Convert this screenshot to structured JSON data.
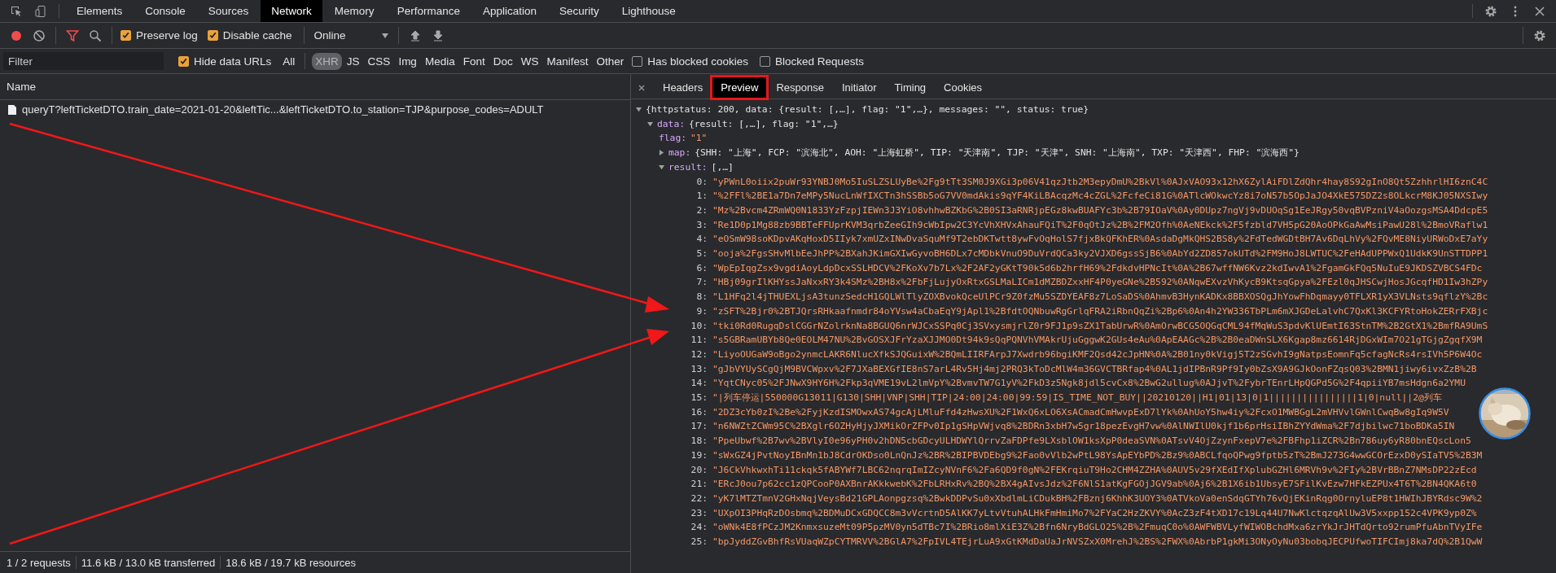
{
  "devtools_tabs": [
    {
      "label": "Elements",
      "selected": false
    },
    {
      "label": "Console",
      "selected": false
    },
    {
      "label": "Sources",
      "selected": false
    },
    {
      "label": "Network",
      "selected": true
    },
    {
      "label": "Memory",
      "selected": false
    },
    {
      "label": "Performance",
      "selected": false
    },
    {
      "label": "Application",
      "selected": false
    },
    {
      "label": "Security",
      "selected": false
    },
    {
      "label": "Lighthouse",
      "selected": false
    }
  ],
  "toolbar": {
    "recording": true,
    "options": [
      {
        "label": "Preserve log",
        "checked": true
      },
      {
        "label": "Disable cache",
        "checked": true
      }
    ],
    "throttling": "Online"
  },
  "filter": {
    "placeholder": "Filter",
    "hide_data_urls": {
      "label": "Hide data URLs",
      "checked": true
    },
    "types": [
      {
        "label": "All",
        "selected": false
      },
      {
        "label": "XHR",
        "selected": true
      },
      {
        "label": "JS",
        "selected": false
      },
      {
        "label": "CSS",
        "selected": false
      },
      {
        "label": "Img",
        "selected": false
      },
      {
        "label": "Media",
        "selected": false
      },
      {
        "label": "Font",
        "selected": false
      },
      {
        "label": "Doc",
        "selected": false
      },
      {
        "label": "WS",
        "selected": false
      },
      {
        "label": "Manifest",
        "selected": false
      },
      {
        "label": "Other",
        "selected": false
      }
    ],
    "options": [
      {
        "label": "Has blocked cookies",
        "checked": false
      },
      {
        "label": "Blocked Requests",
        "checked": false
      }
    ]
  },
  "requests": {
    "column": "Name",
    "rows": [
      {
        "name": "queryT?leftTicketDTO.train_date=2021-01-20&leftTic...&leftTicketDTO.to_station=TJP&purpose_codes=ADULT"
      }
    ]
  },
  "detail_tabs": [
    {
      "label": "Headers",
      "selected": false
    },
    {
      "label": "Preview",
      "selected": true
    },
    {
      "label": "Response",
      "selected": false
    },
    {
      "label": "Initiator",
      "selected": false
    },
    {
      "label": "Timing",
      "selected": false
    },
    {
      "label": "Cookies",
      "selected": false
    }
  ],
  "preview": {
    "kind": "object",
    "preview": "{httpstatus: 200, data: {result: [,…], flag: \"1\",…}, messages: \"\", status: true}",
    "expanded": true,
    "children": [
      {
        "kind": "object",
        "key": "data:",
        "preview": "{result: [,…], flag: \"1\",…}",
        "expanded": true,
        "children": [
          {
            "kind": "leaf",
            "key": "flag:",
            "value": "\"1\""
          },
          {
            "kind": "object",
            "key": "map:",
            "preview": "{SHH: \"上海\", FCP: \"滨海北\", AOH: \"上海虹桥\", TIP: \"天津南\", TJP: \"天津\", SNH: \"上海南\", TXP: \"天津西\", FHP: \"滨海西\"}",
            "expanded": false
          },
          {
            "kind": "array",
            "key": "result:",
            "preview": "[,…]",
            "expanded": true,
            "children": [
              {
                "kind": "leaf",
                "key": "0:",
                "value": "\"yPWnL0oiix2puWr93YNBJ0Mo5IuSLZSLUyBe%2Fg9tTt3SM0J9XGi3p06V41qzJtb2M3epyDmU%2BkVl%0AJxVAO93x12hX6ZylAiFDlZdQhr4hay8S92gInO8Qt5ZzhhrlHI6znC4C"
              },
              {
                "kind": "leaf",
                "key": "1:",
                "value": "\"%2FFl%2BE1a7Dn7eMPy5NucLnWfIXCTn3hSSBb5oG7VV0mdAkis9qYF4KiLBAcqzMc4cZGL%2FcfeCi81G%0ATlcWOkwcYz8i7oN57b5OpJaJO4XkE575DZ2s8OLkcrM8KJ05NXSIwy"
              },
              {
                "kind": "leaf",
                "key": "2:",
                "value": "\"Mz%2Bvcm4ZRmWQ0N1833YzFzpjIEWn3J3YiO8vhhwBZKbG%2B0SI3aRNRjpEGz8kwBUAFYc3b%2B79IOaV%0Ay0DUpz7ngVj9vDUOqSg1EeJRgy50vqBVPzniV4aOozgsMSA4DdcpE5"
              },
              {
                "kind": "leaf",
                "key": "3:",
                "value": "\"Re1D0p1Mg88zb9BBTeFFUprKVM3qrbZeeGIh9cWbIpw2C3YcVhXHVxAhauFQiT%2F0qOtJz%2B%2FM2Ofh%0AeNEkck%2F5fzbld7VH5pG20AoOPkGaAwMsiPawU28l%2BmoVRaflw1"
              },
              {
                "kind": "leaf",
                "key": "4:",
                "value": "\"eOSmW98soKDpvAKqHoxD5IIyk7xmUZxINwDvaSquMf9T2ebDKTwtt8ywFvOqHolS7fjxBkQFKhER%0AsdaDgMkQHS2BS8y%2FdTedWGDtBH7Av6DqLhVy%2FQvME8NiyURWoDxE7aYy"
              },
              {
                "kind": "leaf",
                "key": "5:",
                "value": "\"ooja%2FgsSHvMlbEeJhPP%2BXahJKimGXIwGyvoBH6DLx7cMDbkVnuO9DuVrdQCa3ky2VJXD6gssSjB6%0AbYd2ZD857okUTd%2FM9HoJ8LWTUC%2FeHAdUPPWxQ1UdkK9UnSTTDPP1"
              },
              {
                "kind": "leaf",
                "key": "6:",
                "value": "\"WpEpIqgZsx9vgdiAoyLdpDcxSSLHDCV%2FKoXv7b7Lx%2F2AF2yGKtT90k5d6b2hrfH69%2FdkdvHPNcIt%0A%2B67wffNW6Kvz2kdIwvA1%2FgamGkFQq5NuIuE9JKDSZVBCS4FDc"
              },
              {
                "kind": "leaf",
                "key": "7:",
                "value": "\"HBj09grIlKHYssJaNxxRY3k4SMz%2BH8x%2FbFjLujyOxRtxGSLMaLICm1dMZBDZxxHF4P0yeGNe%2B592%0ANqwEXvzVhKycB9KtsqGpya%2FEzl0qJHSCwjHosJGcqfHD1Iw3hZPy"
              },
              {
                "kind": "leaf",
                "key": "8:",
                "value": "\"L1HFq2l4jTHUEXLjsA3tunzSedcH1GQLWlTlyZOXBvokQceUlPCr9Z0fzMu5SZDYEAF8z7LoSaDS%0AhmvB3HynKADKx8BBXOSQgJhYowFhDqmayy0TFLXR1yX3VLNsts9qflzY%2Bc"
              },
              {
                "kind": "leaf",
                "key": "9:",
                "value": "\"zSFT%2Bjr0%2BTJQrsRHkaafnmdr84oYVsw4aCbaEqY9jApl1%2BfdtOQNbuwRgGrlqFRA2iRbnQqZi%2Bp6%0An4h2YW336TbPLm6mXJGDeLalvhC7QxKl3KCFYRtoHokZERrFXBjc"
              },
              {
                "kind": "leaf",
                "key": "10:",
                "value": "\"tki0Rd0RugqDslCGGrNZolrknNa8BGUQ6nrWJCxSSPq0Cj3SVxysmjrlZ0r9FJ1p9sZX1TabUrwR%0AmOrwBCG5OQGqCML94fMqWuS3pdvKlUEmtI63StnTM%2B2GtX1%2BmfRA9UmS"
              },
              {
                "kind": "leaf",
                "key": "11:",
                "value": "\"s5GBRamUBYb8Qe0EOLM47NU%2BvGOSXJFrYzaXJJMO0Dt94k9sQqPQNVhVMAkrUjuGggwK2GUs4eAu%0ApEAAGc%2B%2B0eaDWnSLX6Kgap8mz6614RjDGxWIm7O21gTGjgZgqfX9M"
              },
              {
                "kind": "leaf",
                "key": "12:",
                "value": "\"LiyoOUGaW9oBgo2ynmcLAKR6NlucXfkSJQGuixW%2BQmLIIRFArpJ7Xwdrb96bgiKMF2Qsd42cJpHN%0A%2B01ny0kVigj5T2zSGvhI9gNatpsEomnFq5cfagNcRs4rsIVh5P6W4Oc"
              },
              {
                "kind": "leaf",
                "key": "13:",
                "value": "\"gJbVYUySCgQjM9BVCWpxv%2F7JXaBEXGfIE8nS7arL4Rv5Hj4mj2PRQ3kToDcMlW4m36GVCTBRfap4%0AL1jdIPBnR9Pf9Iy0bZsX9A9GJkOonFZqsQ03%2BMN1jiwy6ivxZzB%2B"
              },
              {
                "kind": "leaf",
                "key": "14:",
                "value": "\"YqtCNyc05%2FJNwX9HY6H%2Fkp3qVME19vL2lmVpY%2BvmvTW7G1yV%2FkD3z5Ngk8jdl5cvCx8%2BwG2ullug%0AJjvT%2FybrTEnrLHpQGPd5G%2F4qpiiYB7msHdgn6a2YMU"
              },
              {
                "kind": "leaf",
                "key": "15:",
                "value": "\"|列车停运|550000G13011|G130|SHH|VNP|SHH|TIP|24:00|24:00|99:59|IS_TIME_NOT_BUY||20210120||H1|01|13|0|1||||||||||||||||1|0|null||2@列车"
              },
              {
                "kind": "leaf",
                "key": "16:",
                "value": "\"2DZ3cYb0zI%2Be%2FyjKzdISMOwxAS74gcAjLMluFfd4zHwsXU%2F1WxQ6xLO6XsACmadCmHwvpExD7lYk%0AhUoY5hw4iy%2FcxO1MWBGgL2mVHVvlGWnlCwqBw8gIq9W5V"
              },
              {
                "kind": "leaf",
                "key": "17:",
                "value": "\"n6NWZtZCWm95C%2BXglr6OZHyHjyJXMikOrZFPv0Ip1gSHpVWjvq8%2BDRn3xbH7w5gr18pezEvgH7vw%0AlNWIlU0kjf1b6prHsiIBhZYYdWma%2F7djbilwc71boBDKa5IN"
              },
              {
                "kind": "leaf",
                "key": "18:",
                "value": "\"PpeUbwf%2B7wv%2BVlyI0e96yPH0v2hDN5cbGDcyULHDWYlQrrvZaFDPfe9LXsblOW1ksXpP0deaSVN%0ATsvV4OjZzynFxepV7e%2FBFhp1iZCR%2Bn786uy6yR80bnEQscLon5"
              },
              {
                "kind": "leaf",
                "key": "19:",
                "value": "\"sWxGZ4jPvtNoyIBnMn1bJ8CdrOKDso0LnQnJz%2BR%2BIPBVDEbg9%2Fao0vVlb2wPtL98YsApEYbPD%2Bz9%0ABCLfqoQPwg9fptb5zT%2BmJ273G4wwGCOrEzxD0ySIaTV5%2B3M"
              },
              {
                "kind": "leaf",
                "key": "20:",
                "value": "\"J6CkVhkwxhTi11ckqk5fABYWf7LBC62nqrqImIZcyNVnF6%2Fa6QD9f0gN%2FEKrqiuT9Ho2CHM4ZZHA%0AUV5v29fXEdIfXplubGZHl6MRVh9v%2FIy%2BVrBBnZ7NMsDP22zEcd"
              },
              {
                "kind": "leaf",
                "key": "21:",
                "value": "\"ERcJ0ou7p62cc1zQPCooP0AXBnrAKkkwebK%2FbLRHxRv%2BQ%2BX4gAIvsJdz%2F6NlS1atKgFGOjJGV9ab%0Aj6%2B1X6ib1UbsyE7SFilKvEzw7HFkEZPUx4T6T%2BN4QKA6t0"
              },
              {
                "kind": "leaf",
                "key": "22:",
                "value": "\"yK7lMTZTmnV2GHxNqjVeysBd21GPLAonpgzsq%2BwkDDPvSu0xXbdlmLiCDukBH%2FBznj6KhhK3UOY3%0ATVkoVa0enSdqGTYh76vQjEKinRqg0OrnyluEP8t1HWIhJBYRdsc9W%2"
              },
              {
                "kind": "leaf",
                "key": "23:",
                "value": "\"UXpOI3PHqRzDOsbmq%2BDMuDCxGDQCC8m3vVcrtnD5AlKK7yLtvVtuhALHkFmHmiMo7%2FYaC2HzZKVY%0AcZ3zF4tXD17c19Lq44U7NwKlctqzqAlUw3V5xxpp152c4VPK9yp0Z%"
              },
              {
                "kind": "leaf",
                "key": "24:",
                "value": "\"oWNk4E8fPCzJM2KnmxsuzeMt09P5pzMV0yn5dTBc7I%2BRio8mlXiE3Z%2Bfn6NryBdGLO25%2B%2FmuqC0o%0AWFWBVLyfWIWOBchdMxa6zrYkJrJHTdQrto92rumPfuAbnTVyIFe"
              },
              {
                "kind": "leaf",
                "key": "25:",
                "value": "\"bpJyddZGvBhfRsVUaqWZpCYTMRVV%2BGlA7%2FpIVL4TEjrLuA9xGtKMdDaUaJrNVSZxX0MrehJ%2BS%2FWX%0AbrbP1gkMi3ONyOyNu03bobqJECPUfwoTIFCImj8ka7dQ%2B1QwW"
              }
            ]
          }
        ]
      }
    ]
  },
  "status_bar": [
    "1 / 2 requests",
    "11.6 kB / 13.0 kB transferred",
    "18.6 kB / 19.7 kB resources"
  ]
}
